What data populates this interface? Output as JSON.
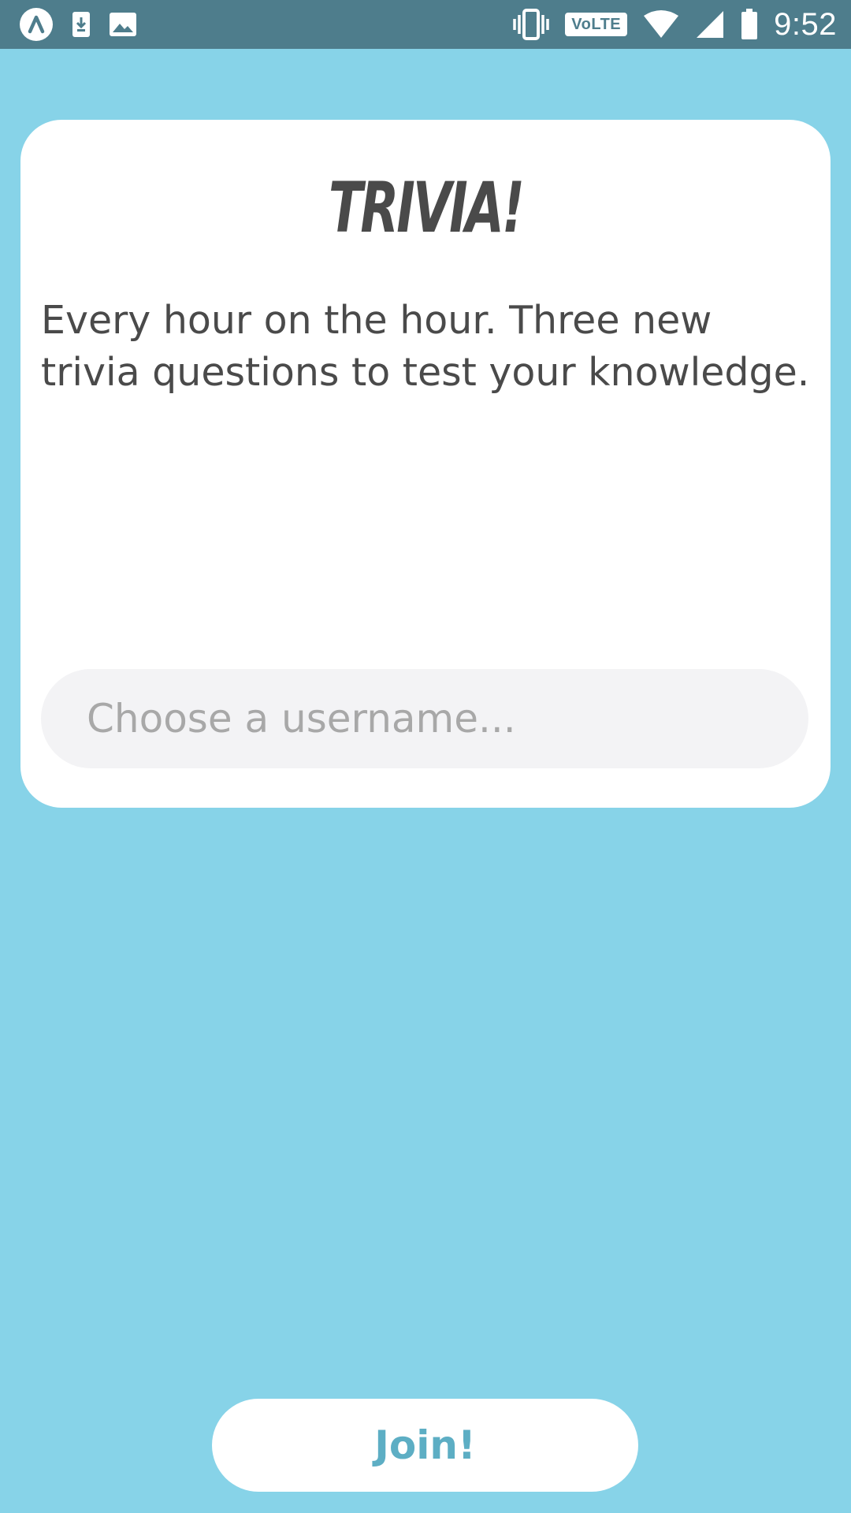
{
  "status_bar": {
    "time": "9:52",
    "network_badge": "VoLTE",
    "left_icons": [
      "app-notification-icon",
      "download-icon",
      "image-icon"
    ],
    "right_icons": [
      "vibrate-icon",
      "volte-icon",
      "wifi-icon",
      "cell-signal-icon",
      "battery-icon"
    ]
  },
  "card": {
    "logo_text": "TRIVIA!",
    "description": "Every hour on the hour. Three new trivia questions to test your knowledge.",
    "username_placeholder": "Choose a username..."
  },
  "join_button_label": "Join!",
  "colors": {
    "background": "#87D3E8",
    "status_bar": "#4E7D8C",
    "card": "#FFFFFF",
    "text": "#4A4A4A",
    "input_bg": "#F3F3F5",
    "accent": "#5DAEC4"
  }
}
